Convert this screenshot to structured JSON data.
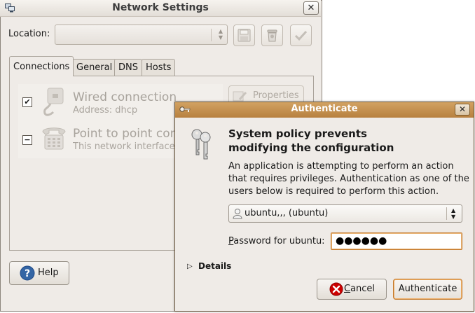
{
  "network_window": {
    "title": "Network Settings",
    "close_glyph": "✕",
    "location_label": "Location:",
    "location_value": "",
    "toolbar": {
      "save_icon": "floppy-disk-icon",
      "delete_icon": "trash-can-icon",
      "apply_icon": "checkmark-icon"
    },
    "tabs": [
      {
        "label": "Connections",
        "active": true
      },
      {
        "label": "General",
        "active": false
      },
      {
        "label": "DNS",
        "active": false
      },
      {
        "label": "Hosts",
        "active": false
      }
    ],
    "connections": [
      {
        "title": "Wired connection",
        "subtitle": "Address: dhcp",
        "checked": true,
        "check_glyph": "✔",
        "icon": "ethernet-plug-icon"
      },
      {
        "title": "Point to point connection",
        "subtitle": "This network interface is not configured",
        "checked": false,
        "check_glyph": "−",
        "icon": "telephone-modem-icon"
      }
    ],
    "properties_label": "Properties",
    "help_label": "Help"
  },
  "auth_dialog": {
    "title": "Authenticate",
    "close_glyph": "✕",
    "heading_line1": "System policy prevents",
    "heading_line2": "modifying the configuration",
    "body": "An application is attempting to perform an action that requires privileges. Authentication as one of the users below is required to perform this action.",
    "user_value": "ubuntu,,, (ubuntu)",
    "password_label_first": "P",
    "password_label_rest": "assword for ubuntu:",
    "password_mask": "●●●●●●",
    "details_arrow": "▷",
    "details_label": "Details",
    "cancel_label_first": "C",
    "cancel_label_rest": "ancel",
    "authenticate_label": "Authenticate"
  },
  "colors": {
    "auth_titlebar": "#c08c4c",
    "focus_orange": "#c47a2c",
    "disabled_text": "#a8a39c"
  }
}
